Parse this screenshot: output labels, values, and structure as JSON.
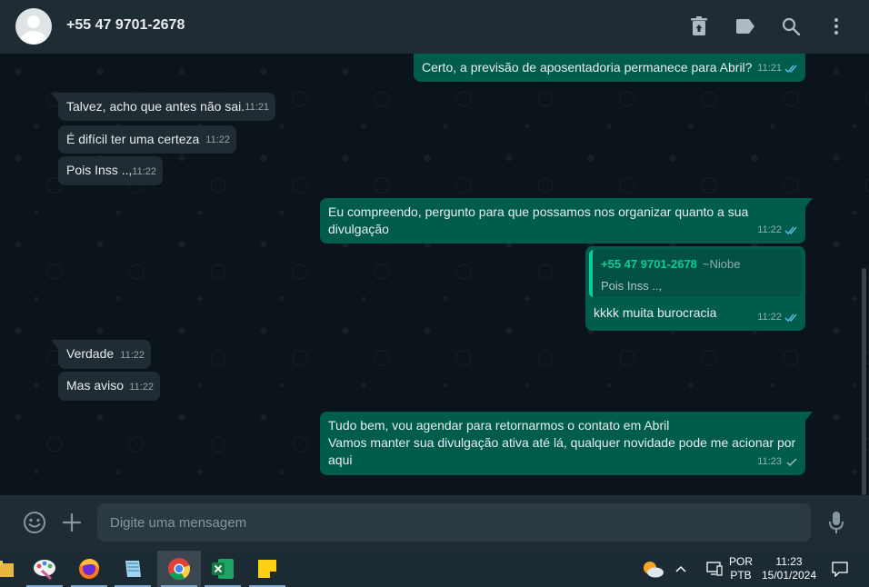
{
  "header": {
    "contact_name": "+55 47 9701-2678"
  },
  "messages": {
    "m1": {
      "text": "Certo, a previsão de aposentadoria permanece para Abril?",
      "time": "11:21"
    },
    "m2": {
      "text": "Talvez, acho que antes não sai.",
      "time": "11:21"
    },
    "m3": {
      "text": "É difícil ter uma certeza",
      "time": "11:22"
    },
    "m4": {
      "text": "Pois Inss ..,",
      "time": "11:22"
    },
    "m5": {
      "line1": "Eu compreendo, pergunto para que possamos nos organizar quanto a sua",
      "line2": "divulgação",
      "time": "11:22"
    },
    "m6": {
      "quote_author": "+55 47 9701-2678",
      "quote_pushname": "~Niobe",
      "quote_text": "Pois Inss ..,",
      "text": "kkkk muita burocracia",
      "time": "11:22"
    },
    "m7": {
      "text": "Verdade",
      "time": "11:22"
    },
    "m8": {
      "text": "Mas aviso",
      "time": "11:22"
    },
    "m9": {
      "line1": "Tudo bem, vou agendar para retornarmos o contato em Abril",
      "line2": "Vamos manter sua divulgação ativa até lá, qualquer novidade pode me acionar por",
      "line3": "aqui",
      "time": "11:23"
    }
  },
  "composer": {
    "placeholder": "Digite uma mensagem"
  },
  "taskbar": {
    "lang_top": "POR",
    "lang_bottom": "PTB",
    "clock_time": "11:23",
    "clock_date": "15/01/2024"
  },
  "colors": {
    "incoming_bubble": "#202c33",
    "outgoing_bubble": "#005c4b",
    "read_tick": "#53bdeb",
    "accent": "#06cf9c"
  }
}
